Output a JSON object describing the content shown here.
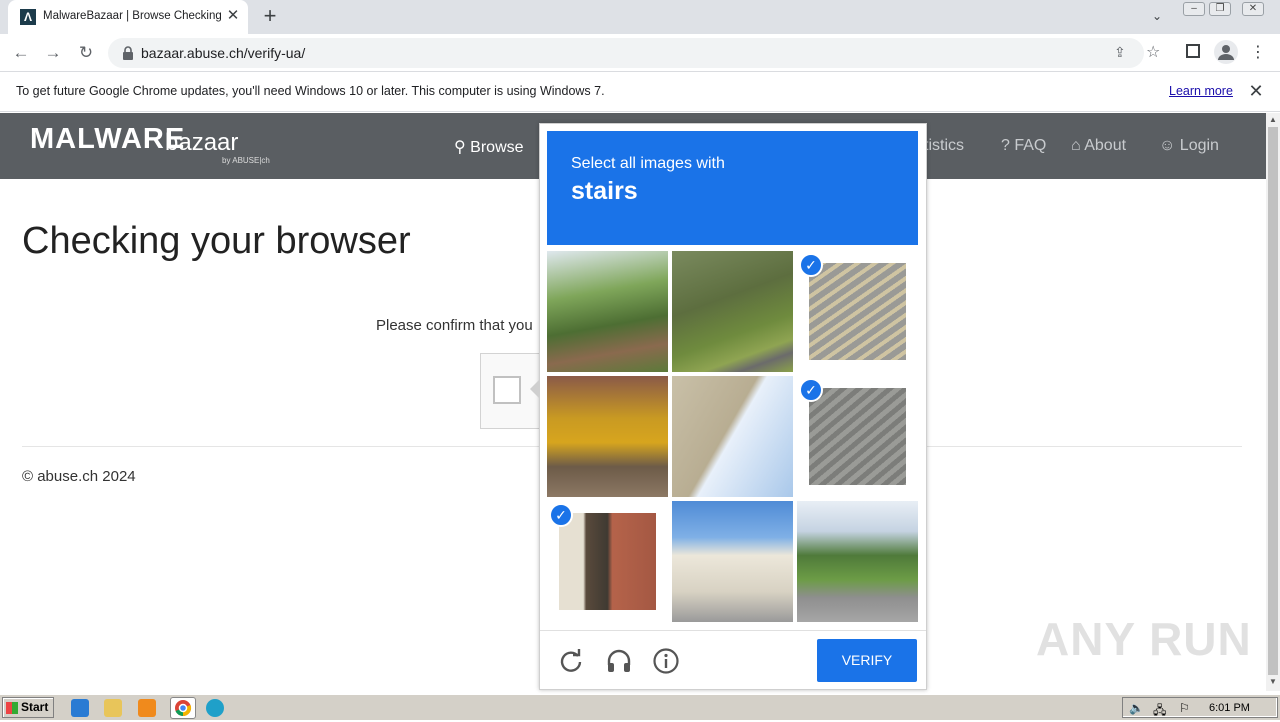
{
  "browser": {
    "tab_title": "MalwareBazaar | Browse Checking y",
    "tab_favicon": "Λ",
    "url": "bazaar.abuse.ch/verify-ua/"
  },
  "infobar": {
    "message": "To get future Google Chrome updates, you'll need Windows 10 or later. This computer is using Windows 7.",
    "link": "Learn more"
  },
  "site": {
    "logo_main": "MALWARE",
    "logo_sub": "bazaar",
    "logo_by": "by ABUSE|ch",
    "nav": {
      "browse": "Browse",
      "statistics": "Statistics",
      "faq": "FAQ",
      "about": "About",
      "login": "Login"
    },
    "heading": "Checking your browser",
    "confirm_text": "Please confirm that you",
    "footer": "© abuse.ch 2024"
  },
  "challenge": {
    "prompt_line1": "Select all images with",
    "prompt_line2": "stairs",
    "verify_label": "VERIFY",
    "tiles": [
      {
        "name": "garden-path",
        "selected": false
      },
      {
        "name": "hillside-road",
        "selected": false
      },
      {
        "name": "outdoor-stairs",
        "selected": true
      },
      {
        "name": "yellow-shrub",
        "selected": false
      },
      {
        "name": "balcony-building",
        "selected": false
      },
      {
        "name": "concrete-stairs",
        "selected": true
      },
      {
        "name": "entrance-stairs",
        "selected": true
      },
      {
        "name": "street-houses",
        "selected": false
      },
      {
        "name": "residential-street",
        "selected": false
      }
    ]
  },
  "taskbar": {
    "start_label": "Start",
    "clock": "6:01 PM"
  },
  "watermark": "ANY RUN",
  "colors": {
    "accent": "#1a73e8",
    "header": "#5a5e62"
  }
}
